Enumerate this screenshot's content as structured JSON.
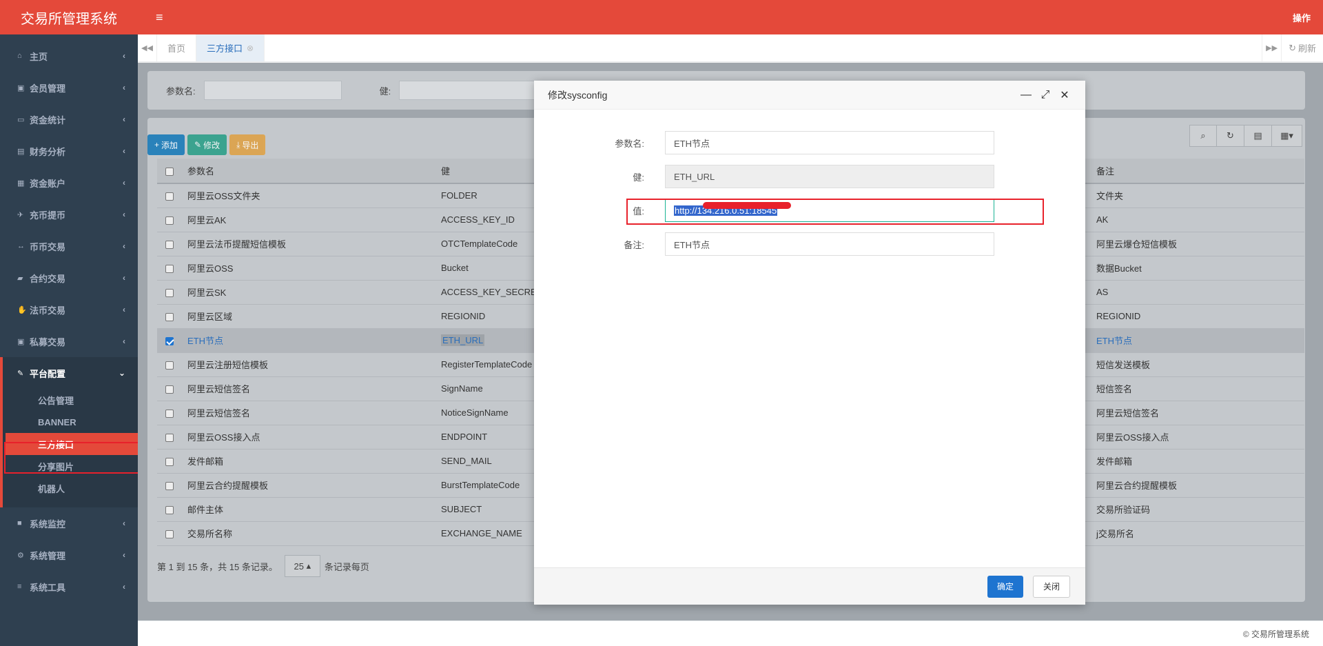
{
  "app": {
    "title": "交易所管理系统",
    "top_action": "操作",
    "footer": "© 交易所管理系统"
  },
  "sidebar": {
    "items": [
      {
        "label": "主页",
        "icon": "home-icon"
      },
      {
        "label": "会员管理",
        "icon": "user-card-icon"
      },
      {
        "label": "资金统计",
        "icon": "card-icon"
      },
      {
        "label": "财务分析",
        "icon": "chart-icon"
      },
      {
        "label": "资金账户",
        "icon": "building-icon"
      },
      {
        "label": "充币提币",
        "icon": "plane-icon"
      },
      {
        "label": "币币交易",
        "icon": "arrows-icon"
      },
      {
        "label": "合约交易",
        "icon": "book-icon"
      },
      {
        "label": "法币交易",
        "icon": "handshake-icon"
      },
      {
        "label": "私募交易",
        "icon": "user-card-icon"
      }
    ],
    "group": {
      "label": "平台配置",
      "sub": [
        "公告管理",
        "BANNER",
        "三方接口",
        "分享图片",
        "机器人"
      ]
    },
    "items_after": [
      {
        "label": "系统监控",
        "icon": "video-icon"
      },
      {
        "label": "系统管理",
        "icon": "gear-icon"
      },
      {
        "label": "系统工具",
        "icon": "list-icon"
      }
    ]
  },
  "tabs": {
    "home": "首页",
    "current": "三方接口",
    "refresh": "刷新"
  },
  "search": {
    "param_label": "参数名:",
    "key_label": "健:"
  },
  "toolbar": {
    "add": "添加",
    "edit": "修改",
    "export": "导出"
  },
  "table": {
    "headers": [
      "参数名",
      "健",
      "备注"
    ],
    "rows": [
      {
        "name": "阿里云OSS文件夹",
        "key": "FOLDER",
        "note": "文件夹"
      },
      {
        "name": "阿里云AK",
        "key": "ACCESS_KEY_ID",
        "note": "AK"
      },
      {
        "name": "阿里云法币提醒短信模板",
        "key": "OTCTemplateCode",
        "note": "阿里云爆仓短信模板"
      },
      {
        "name": "阿里云OSS",
        "key": "Bucket",
        "note": "数据Bucket"
      },
      {
        "name": "阿里云SK",
        "key": "ACCESS_KEY_SECRE",
        "note": "AS"
      },
      {
        "name": "阿里云区域",
        "key": "REGIONID",
        "note": "REGIONID"
      },
      {
        "name": "ETH节点",
        "key": "ETH_URL",
        "note": "ETH节点",
        "selected": true
      },
      {
        "name": "阿里云注册短信模板",
        "key": "RegisterTemplateCode",
        "note": "短信发送模板"
      },
      {
        "name": "阿里云短信签名",
        "key": "SignName",
        "note": "短信签名"
      },
      {
        "name": "阿里云短信签名",
        "key": "NoticeSignName",
        "note": "阿里云短信签名"
      },
      {
        "name": "阿里云OSS接入点",
        "key": "ENDPOINT",
        "note": "阿里云OSS接入点"
      },
      {
        "name": "发件邮箱",
        "key": "SEND_MAIL",
        "note": "发件邮箱"
      },
      {
        "name": "阿里云合约提醒模板",
        "key": "BurstTemplateCode",
        "note": "阿里云合约提醒模板"
      },
      {
        "name": "邮件主体",
        "key": "SUBJECT",
        "note": "交易所验证码"
      },
      {
        "name": "交易所名称",
        "key": "EXCHANGE_NAME",
        "note": "j交易所名"
      }
    ]
  },
  "pager": {
    "summary": "第 1 到 15 条，共 15 条记录。",
    "size": "25",
    "suffix": "条记录每页"
  },
  "modal": {
    "title": "修改sysconfig",
    "fields": [
      {
        "label": "参数名:",
        "value": "ETH节点"
      },
      {
        "label": "健:",
        "value": "ETH_URL"
      },
      {
        "label": "值:",
        "value": "http://134.216.0.51:18545"
      },
      {
        "label": "备注:",
        "value": "ETH节点"
      }
    ],
    "confirm": "确定",
    "close": "关闭"
  }
}
